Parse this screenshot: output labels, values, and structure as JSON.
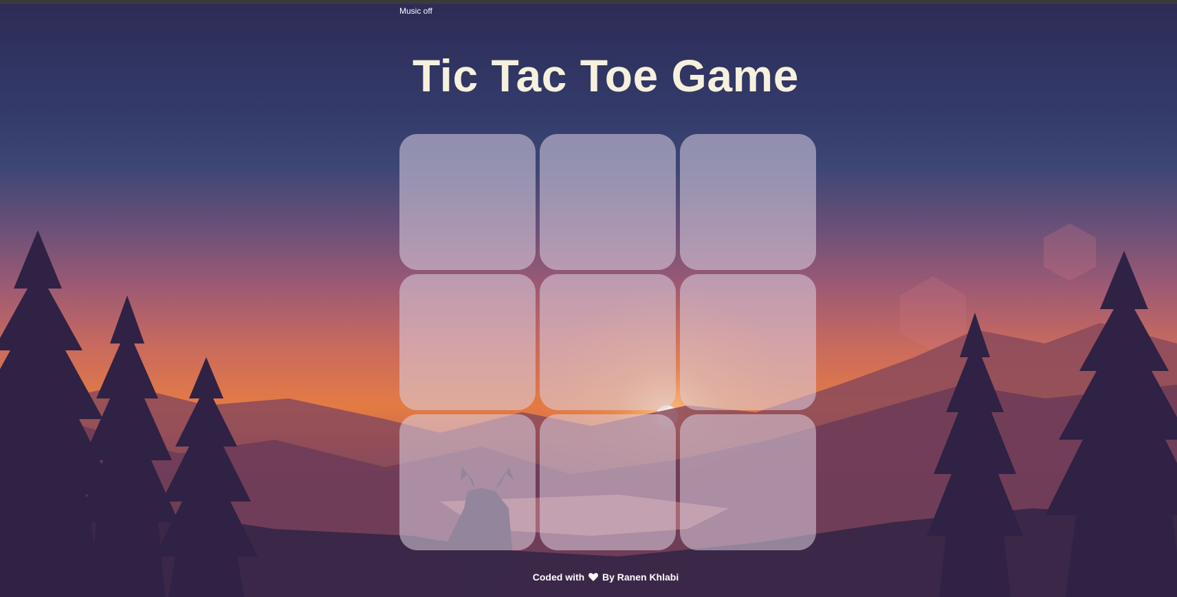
{
  "music_toggle": "Music off",
  "title": "Tic Tac Toe Game",
  "board": {
    "cells": [
      "",
      "",
      "",
      "",
      "",
      "",
      "",
      "",
      ""
    ]
  },
  "footer": {
    "prefix": "Coded with",
    "heart_icon": "heart-icon",
    "suffix": "By Ranen Khlabi"
  },
  "colors": {
    "title": "#f6f1dc",
    "cell_fill": "rgba(220,210,225,0.55)",
    "sky_top": "#2c2b55",
    "sunset": "#e47b44"
  }
}
